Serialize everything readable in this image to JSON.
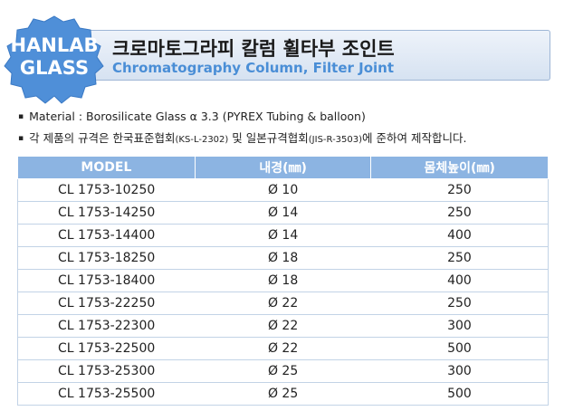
{
  "header": {
    "logo_line1": "HANLAB",
    "logo_line2": "GLASS",
    "title_ko": "크로마토그라피 칼럼 휠타부 조인트",
    "title_en": "Chromatography Column, Filter Joint",
    "logo_color": "#4f8fd8"
  },
  "spec": {
    "bullet": "▪",
    "line1": "Material  : Borosilicate Glass α 3.3 (PYREX Tubing & balloon)",
    "line2_a": "각 제품의 규격은 한국표준협회",
    "line2_b": "(KS-L-2302)",
    "line2_c": " 및 일본규격협회",
    "line2_d": "(JIS-R-3503)",
    "line2_e": "에 준하여 제작합니다."
  },
  "table": {
    "columns": [
      "MODEL",
      "내경(㎜)",
      "몸체높이(㎜)"
    ],
    "rows": [
      [
        "CL 1753-10250",
        "Ø 10",
        "250"
      ],
      [
        "CL 1753-14250",
        "Ø 14",
        "250"
      ],
      [
        "CL 1753-14400",
        "Ø 14",
        "400"
      ],
      [
        "CL 1753-18250",
        "Ø 18",
        "250"
      ],
      [
        "CL 1753-18400",
        "Ø 18",
        "400"
      ],
      [
        "CL 1753-22250",
        "Ø 22",
        "250"
      ],
      [
        "CL 1753-22300",
        "Ø 22",
        "300"
      ],
      [
        "CL 1753-22500",
        "Ø 22",
        "500"
      ],
      [
        "CL 1753-25300",
        "Ø 25",
        "300"
      ],
      [
        "CL 1753-25500",
        "Ø 25",
        "500"
      ]
    ],
    "header_color": "#8cb4e2"
  }
}
